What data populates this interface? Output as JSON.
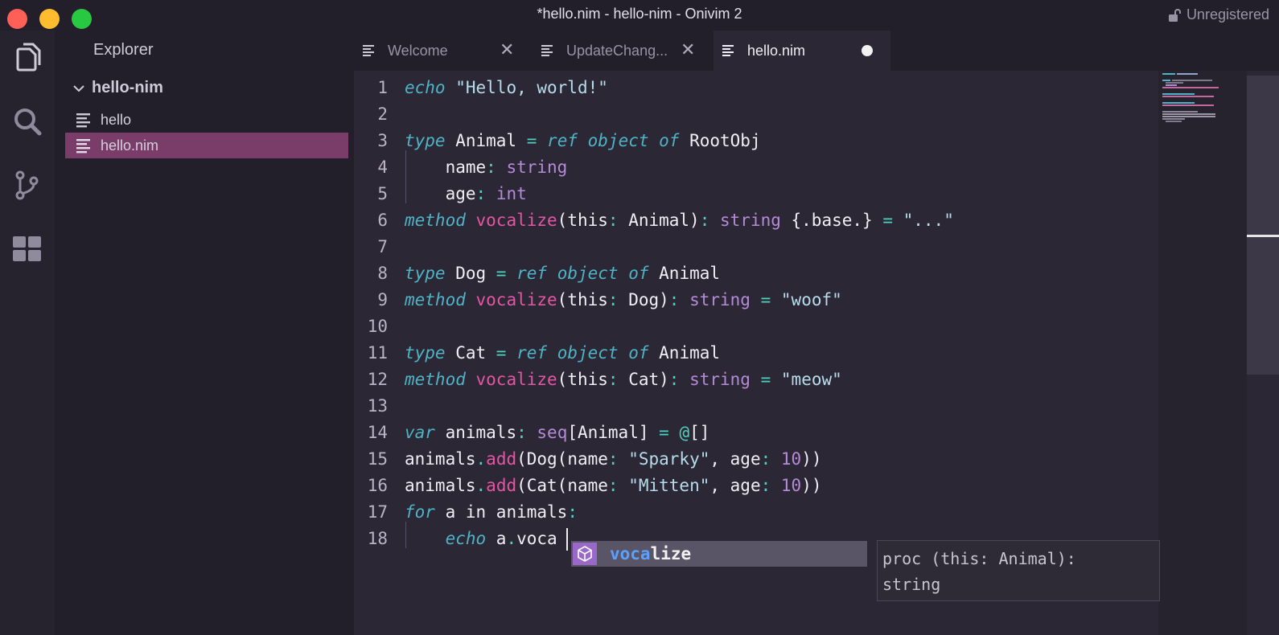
{
  "window": {
    "title": "*hello.nim - hello-nim - Onivim 2",
    "license_status": "Unregistered"
  },
  "activity_bar": {
    "items": [
      "files-icon",
      "search-icon",
      "source-control-icon",
      "extensions-icon"
    ]
  },
  "sidebar": {
    "title": "Explorer",
    "folder": "hello-nim",
    "files": [
      {
        "name": "hello",
        "selected": false
      },
      {
        "name": "hello.nim",
        "selected": true
      }
    ]
  },
  "tabs": [
    {
      "label": "Welcome",
      "active": false,
      "modified": false
    },
    {
      "label": "UpdateChang...",
      "active": false,
      "modified": false
    },
    {
      "label": "hello.nim",
      "active": true,
      "modified": true
    }
  ],
  "tab_close_glyph": "✕",
  "editor": {
    "line_numbers": [
      "1",
      "2",
      "3",
      "4",
      "5",
      "6",
      "7",
      "8",
      "9",
      "10",
      "11",
      "12",
      "13",
      "14",
      "15",
      "16",
      "17",
      "18"
    ],
    "lines": [
      [
        {
          "t": "echo",
          "c": "kw"
        },
        {
          "t": " ",
          "c": "plain"
        },
        {
          "t": "\"Hello, world!\"",
          "c": "str"
        }
      ],
      [],
      [
        {
          "t": "type",
          "c": "kw"
        },
        {
          "t": " Animal ",
          "c": "plain"
        },
        {
          "t": "=",
          "c": "op"
        },
        {
          "t": " ",
          "c": "plain"
        },
        {
          "t": "ref",
          "c": "kw"
        },
        {
          "t": " ",
          "c": "plain"
        },
        {
          "t": "object",
          "c": "kw"
        },
        {
          "t": " ",
          "c": "plain"
        },
        {
          "t": "of",
          "c": "kw"
        },
        {
          "t": " RootObj",
          "c": "plain"
        }
      ],
      [
        {
          "t": "    name",
          "c": "plain"
        },
        {
          "t": ":",
          "c": "op"
        },
        {
          "t": " ",
          "c": "plain"
        },
        {
          "t": "string",
          "c": "typ"
        }
      ],
      [
        {
          "t": "    age",
          "c": "plain"
        },
        {
          "t": ":",
          "c": "op"
        },
        {
          "t": " ",
          "c": "plain"
        },
        {
          "t": "int",
          "c": "typ"
        }
      ],
      [
        {
          "t": "method",
          "c": "kw"
        },
        {
          "t": " ",
          "c": "plain"
        },
        {
          "t": "vocalize",
          "c": "fn"
        },
        {
          "t": "(this",
          "c": "plain"
        },
        {
          "t": ":",
          "c": "op"
        },
        {
          "t": " Animal)",
          "c": "plain"
        },
        {
          "t": ":",
          "c": "op"
        },
        {
          "t": " ",
          "c": "plain"
        },
        {
          "t": "string",
          "c": "typ"
        },
        {
          "t": " {.base.} ",
          "c": "plain"
        },
        {
          "t": "=",
          "c": "op"
        },
        {
          "t": " ",
          "c": "plain"
        },
        {
          "t": "\"...\"",
          "c": "str"
        }
      ],
      [],
      [
        {
          "t": "type",
          "c": "kw"
        },
        {
          "t": " Dog ",
          "c": "plain"
        },
        {
          "t": "=",
          "c": "op"
        },
        {
          "t": " ",
          "c": "plain"
        },
        {
          "t": "ref",
          "c": "kw"
        },
        {
          "t": " ",
          "c": "plain"
        },
        {
          "t": "object",
          "c": "kw"
        },
        {
          "t": " ",
          "c": "plain"
        },
        {
          "t": "of",
          "c": "kw"
        },
        {
          "t": " Animal",
          "c": "plain"
        }
      ],
      [
        {
          "t": "method",
          "c": "kw"
        },
        {
          "t": " ",
          "c": "plain"
        },
        {
          "t": "vocalize",
          "c": "fn"
        },
        {
          "t": "(this",
          "c": "plain"
        },
        {
          "t": ":",
          "c": "op"
        },
        {
          "t": " Dog)",
          "c": "plain"
        },
        {
          "t": ":",
          "c": "op"
        },
        {
          "t": " ",
          "c": "plain"
        },
        {
          "t": "string",
          "c": "typ"
        },
        {
          "t": " ",
          "c": "plain"
        },
        {
          "t": "=",
          "c": "op"
        },
        {
          "t": " ",
          "c": "plain"
        },
        {
          "t": "\"woof\"",
          "c": "str"
        }
      ],
      [],
      [
        {
          "t": "type",
          "c": "kw"
        },
        {
          "t": " Cat ",
          "c": "plain"
        },
        {
          "t": "=",
          "c": "op"
        },
        {
          "t": " ",
          "c": "plain"
        },
        {
          "t": "ref",
          "c": "kw"
        },
        {
          "t": " ",
          "c": "plain"
        },
        {
          "t": "object",
          "c": "kw"
        },
        {
          "t": " ",
          "c": "plain"
        },
        {
          "t": "of",
          "c": "kw"
        },
        {
          "t": " Animal",
          "c": "plain"
        }
      ],
      [
        {
          "t": "method",
          "c": "kw"
        },
        {
          "t": " ",
          "c": "plain"
        },
        {
          "t": "vocalize",
          "c": "fn"
        },
        {
          "t": "(this",
          "c": "plain"
        },
        {
          "t": ":",
          "c": "op"
        },
        {
          "t": " Cat)",
          "c": "plain"
        },
        {
          "t": ":",
          "c": "op"
        },
        {
          "t": " ",
          "c": "plain"
        },
        {
          "t": "string",
          "c": "typ"
        },
        {
          "t": " ",
          "c": "plain"
        },
        {
          "t": "=",
          "c": "op"
        },
        {
          "t": " ",
          "c": "plain"
        },
        {
          "t": "\"meow\"",
          "c": "str"
        }
      ],
      [],
      [
        {
          "t": "var",
          "c": "kw"
        },
        {
          "t": " animals",
          "c": "plain"
        },
        {
          "t": ":",
          "c": "op"
        },
        {
          "t": " ",
          "c": "plain"
        },
        {
          "t": "seq",
          "c": "typ"
        },
        {
          "t": "[Animal] ",
          "c": "plain"
        },
        {
          "t": "=",
          "c": "op"
        },
        {
          "t": " ",
          "c": "plain"
        },
        {
          "t": "@",
          "c": "op"
        },
        {
          "t": "[]",
          "c": "plain"
        }
      ],
      [
        {
          "t": "animals",
          "c": "plain"
        },
        {
          "t": ".",
          "c": "op"
        },
        {
          "t": "add",
          "c": "fn"
        },
        {
          "t": "(Dog(name",
          "c": "plain"
        },
        {
          "t": ":",
          "c": "op"
        },
        {
          "t": " ",
          "c": "plain"
        },
        {
          "t": "\"Sparky\"",
          "c": "str"
        },
        {
          "t": ", age",
          "c": "plain"
        },
        {
          "t": ":",
          "c": "op"
        },
        {
          "t": " ",
          "c": "plain"
        },
        {
          "t": "10",
          "c": "num"
        },
        {
          "t": "))",
          "c": "plain"
        }
      ],
      [
        {
          "t": "animals",
          "c": "plain"
        },
        {
          "t": ".",
          "c": "op"
        },
        {
          "t": "add",
          "c": "fn"
        },
        {
          "t": "(Cat(name",
          "c": "plain"
        },
        {
          "t": ":",
          "c": "op"
        },
        {
          "t": " ",
          "c": "plain"
        },
        {
          "t": "\"Mitten\"",
          "c": "str"
        },
        {
          "t": ", age",
          "c": "plain"
        },
        {
          "t": ":",
          "c": "op"
        },
        {
          "t": " ",
          "c": "plain"
        },
        {
          "t": "10",
          "c": "num"
        },
        {
          "t": "))",
          "c": "plain"
        }
      ],
      [
        {
          "t": "for",
          "c": "kw"
        },
        {
          "t": " a in animals",
          "c": "plain"
        },
        {
          "t": ":",
          "c": "op"
        }
      ],
      [
        {
          "t": "    ",
          "c": "plain"
        },
        {
          "t": "echo",
          "c": "kw"
        },
        {
          "t": " a",
          "c": "plain"
        },
        {
          "t": ".",
          "c": "op"
        },
        {
          "t": "voca",
          "c": "plain"
        }
      ]
    ]
  },
  "completion": {
    "match": "voca",
    "rest": "lize",
    "detail_line1": "proc (this: Animal):",
    "detail_line2": "string"
  },
  "colors": {
    "keyword": "#4fb3c6",
    "string": "#b7dcec",
    "type": "#b58bd8",
    "function": "#e455a3",
    "operator": "#4fd1c0",
    "selection": "#7a3c68"
  }
}
